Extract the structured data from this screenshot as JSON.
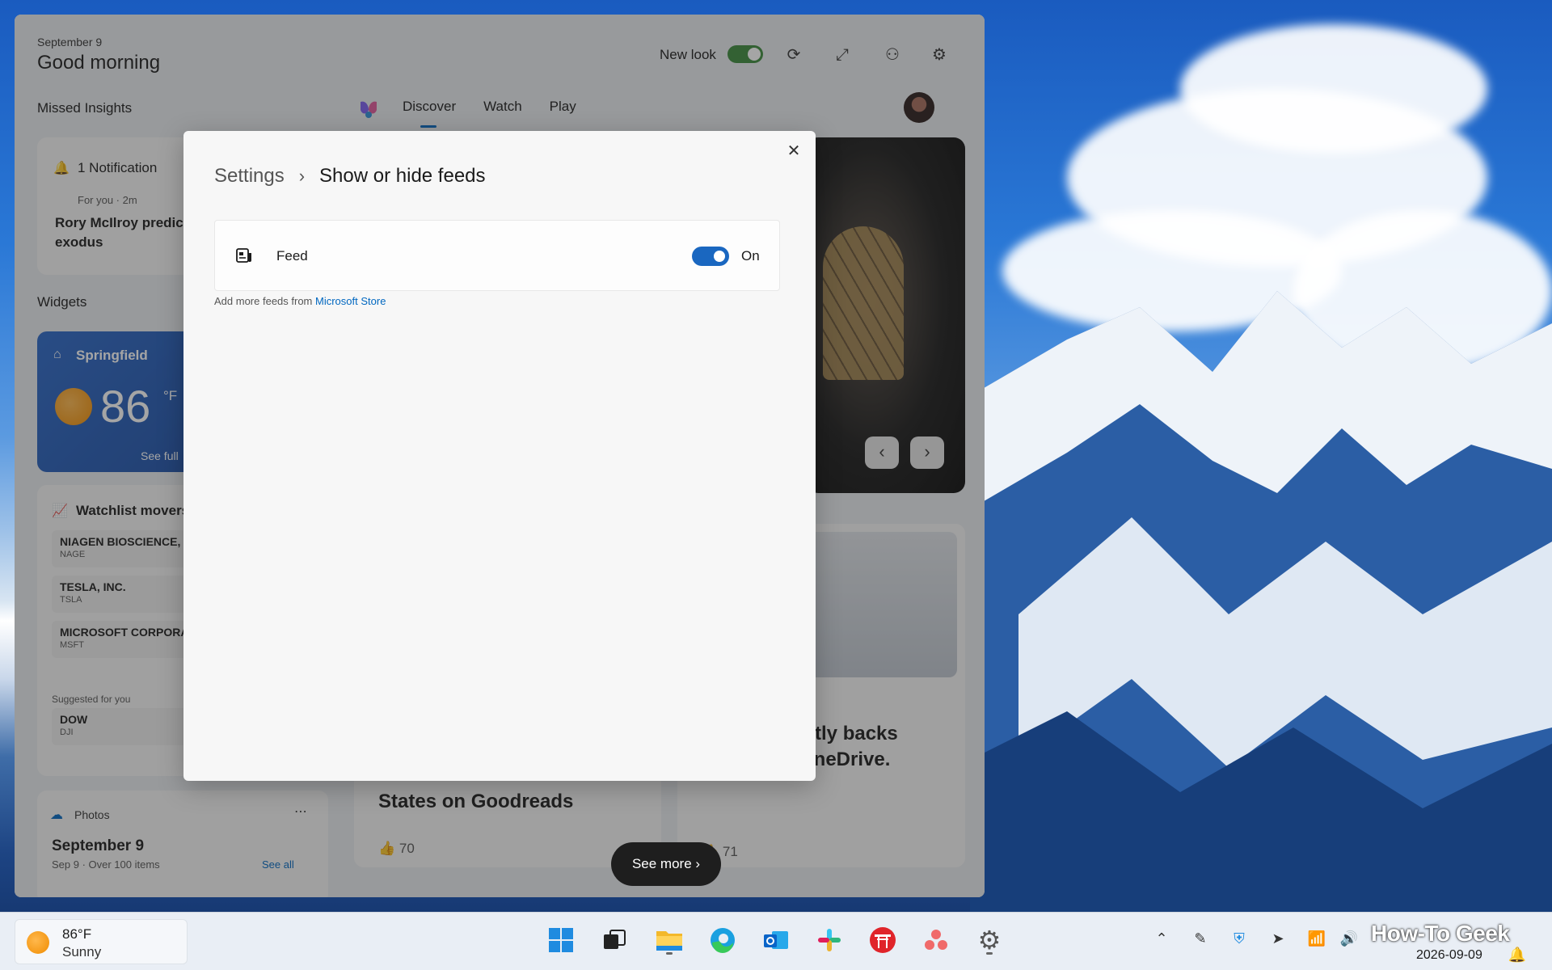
{
  "board": {
    "date": "September 9",
    "greeting": "Good morning",
    "new_look_label": "New look",
    "missed_insights": "Missed Insights",
    "tabs": [
      "Discover",
      "Watch",
      "Play"
    ],
    "widgets_label": "Widgets"
  },
  "notification": {
    "title": "1 Notification",
    "meta": "For you · 2m",
    "body": "Rory McIlroy predict exodus"
  },
  "weather_widget": {
    "location": "Springfield",
    "temp": "86",
    "unit": "°F",
    "see_full": "See full"
  },
  "watchlist": {
    "title": "Watchlist movers",
    "stocks": [
      {
        "name": "NIAGEN BIOSCIENCE, I",
        "ticker": "NAGE"
      },
      {
        "name": "TESLA, INC.",
        "ticker": "TSLA"
      },
      {
        "name": "MICROSOFT CORPORA",
        "ticker": "MSFT"
      }
    ],
    "suggested_label": "Suggested for you",
    "suggested": [
      {
        "name": "DOW",
        "ticker": "DJI"
      }
    ]
  },
  "photos": {
    "title": "Photos",
    "date": "September 9",
    "sub": "Sep 9 · Over 100 items",
    "see_all": "See all"
  },
  "articles": {
    "a1_title": "States on Goodreads",
    "a1_likes": "70",
    "a2_title": "ietly backs\n OneDrive.",
    "a2_likes": "71"
  },
  "see_more": "See more",
  "dialog": {
    "breadcrumb_root": "Settings",
    "breadcrumb_current": "Show or hide feeds",
    "feed_label": "Feed",
    "feed_state": "On",
    "add_more_prefix": "Add more feeds from",
    "add_more_link": "Microsoft Store"
  },
  "taskbar": {
    "weather_temp": "86°F",
    "weather_cond": "Sunny",
    "date": "2026-09-09",
    "watermark": "How-To Geek"
  },
  "colors": {
    "accent": "#0067c0",
    "toggle_on": "#1a67c0",
    "new_look_toggle": "#3c8a3c"
  }
}
